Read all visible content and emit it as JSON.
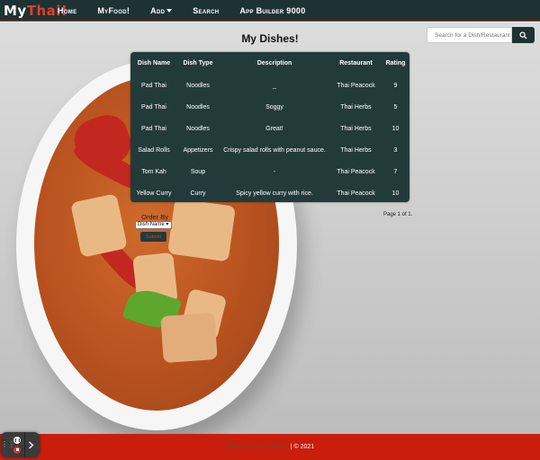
{
  "navbar": {
    "brand_my": "My",
    "brand_thai": "Thai!",
    "items": [
      {
        "label": "Home"
      },
      {
        "label": "MyFood!"
      },
      {
        "label": "Add"
      },
      {
        "label": "Search"
      },
      {
        "label": "App Builder 9000"
      }
    ]
  },
  "search": {
    "placeholder": "Search for a Dish/Restaurant"
  },
  "page": {
    "title": "My Dishes!"
  },
  "table": {
    "headers": [
      "Dish Name",
      "Dish Type",
      "Description",
      "Restaurant",
      "Rating"
    ],
    "rows": [
      [
        "Pad Thai",
        "Noodles",
        "_",
        "Thai Peacock",
        "9"
      ],
      [
        "Pad Thai",
        "Noodles",
        "Soggy",
        "Thai Herbs",
        "5"
      ],
      [
        "Pad Thai",
        "Noodles",
        "Great!",
        "Thai Herbs",
        "10"
      ],
      [
        "Salad Rolls",
        "Appetizers",
        "Crispy salad rolls with peanut sauce.",
        "Thai Herbs",
        "3"
      ],
      [
        "Tom Kah",
        "Soup",
        "-",
        "Thai Peacock",
        "7"
      ],
      [
        "Yellow Curry",
        "Curry",
        "Spicy yellow curry with rice.",
        "Thai Peacock",
        "10"
      ]
    ]
  },
  "pagination": {
    "text": "Page 1 of 1."
  },
  "order": {
    "label": "Order By",
    "selected": "Dish Name",
    "submit_label": "Submit"
  },
  "footer": {
    "author": "Katherine Nahe Mettler",
    "copyright": " | © 2021"
  },
  "colors": {
    "navbar": "#1f3233",
    "table_bg": "#233a3b",
    "footer": "#c91e0c",
    "brand_accent": "#e0402a"
  }
}
